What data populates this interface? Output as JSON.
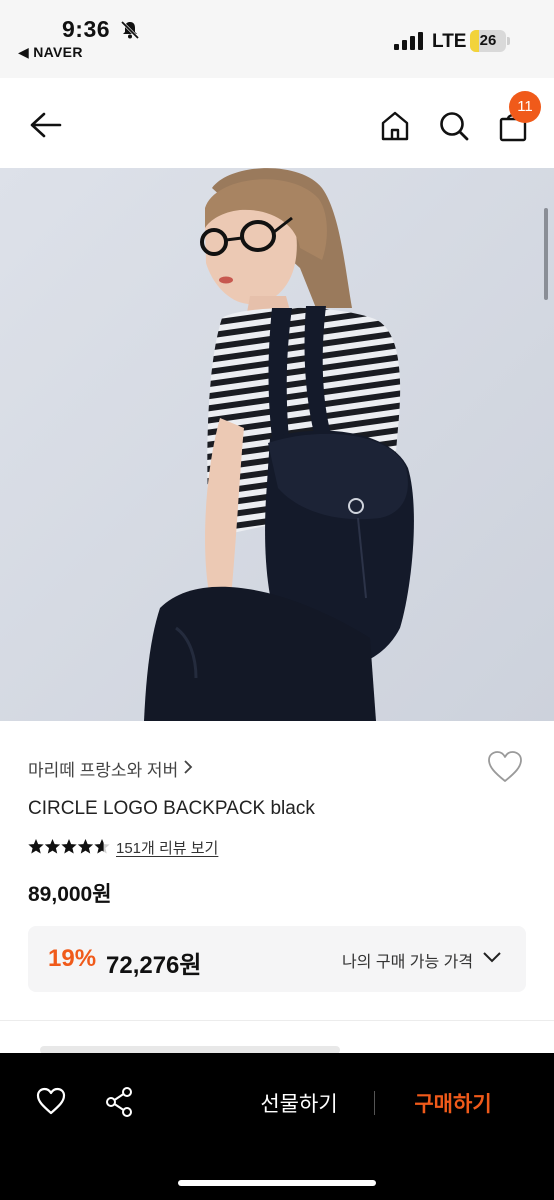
{
  "status_bar": {
    "time": "9:36",
    "back_app": "◀ NAVER",
    "network": "LTE",
    "battery_level": "26",
    "battery_fraction": 0.26
  },
  "header": {
    "icons": [
      "back-arrow-icon",
      "home-icon",
      "search-icon",
      "cart-icon"
    ],
    "cart_count": "11"
  },
  "product": {
    "brand": "마리떼 프랑소와 저버",
    "name": "CIRCLE LOGO BACKPACK black",
    "rating": 4.6,
    "review_link": "151개 리뷰 보기",
    "original_price": "89,000원",
    "discount_rate": "19%",
    "sale_price": "72,276원",
    "my_price_label": "나의 구매 가능 가격"
  },
  "bottom_bar": {
    "gift_label": "선물하기",
    "buy_label": "구매하기"
  },
  "colors": {
    "accent": "#f05a1a",
    "bottom_bar_bg": "#000000",
    "price_box_bg": "#f5f5f6"
  }
}
